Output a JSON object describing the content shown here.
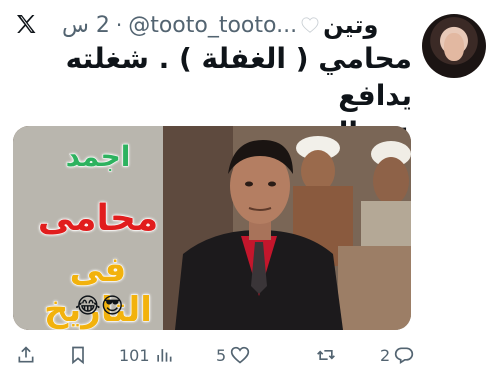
{
  "header": {
    "display_name": "وتين",
    "handle": "@tooto_tooto...",
    "separator": "·",
    "time": "2 س"
  },
  "tweet": {
    "line1": "محامي ( الغفلة ) . شغلته يدافع",
    "line2": "عن الحريم بس"
  },
  "media": {
    "overlay_line1": "اجمد",
    "overlay_line2": "محامى",
    "overlay_line3": "فى التاريخ",
    "emoji": "😂😎"
  },
  "actions": {
    "reply_count": "2",
    "retweet_count": "",
    "like_count": "5",
    "views_count": "101"
  },
  "icons": {
    "brand": "x-logo-icon",
    "heart": "white-heart-icon",
    "reply": "reply-icon",
    "retweet": "retweet-icon",
    "like": "like-icon",
    "views": "views-icon",
    "bookmark": "bookmark-icon",
    "share": "share-icon"
  },
  "colors": {
    "text": "#0f1419",
    "muted": "#536471",
    "overlay_green": "#2db25f",
    "overlay_red": "#e11d1d",
    "overlay_yellow": "#f2b20d"
  }
}
